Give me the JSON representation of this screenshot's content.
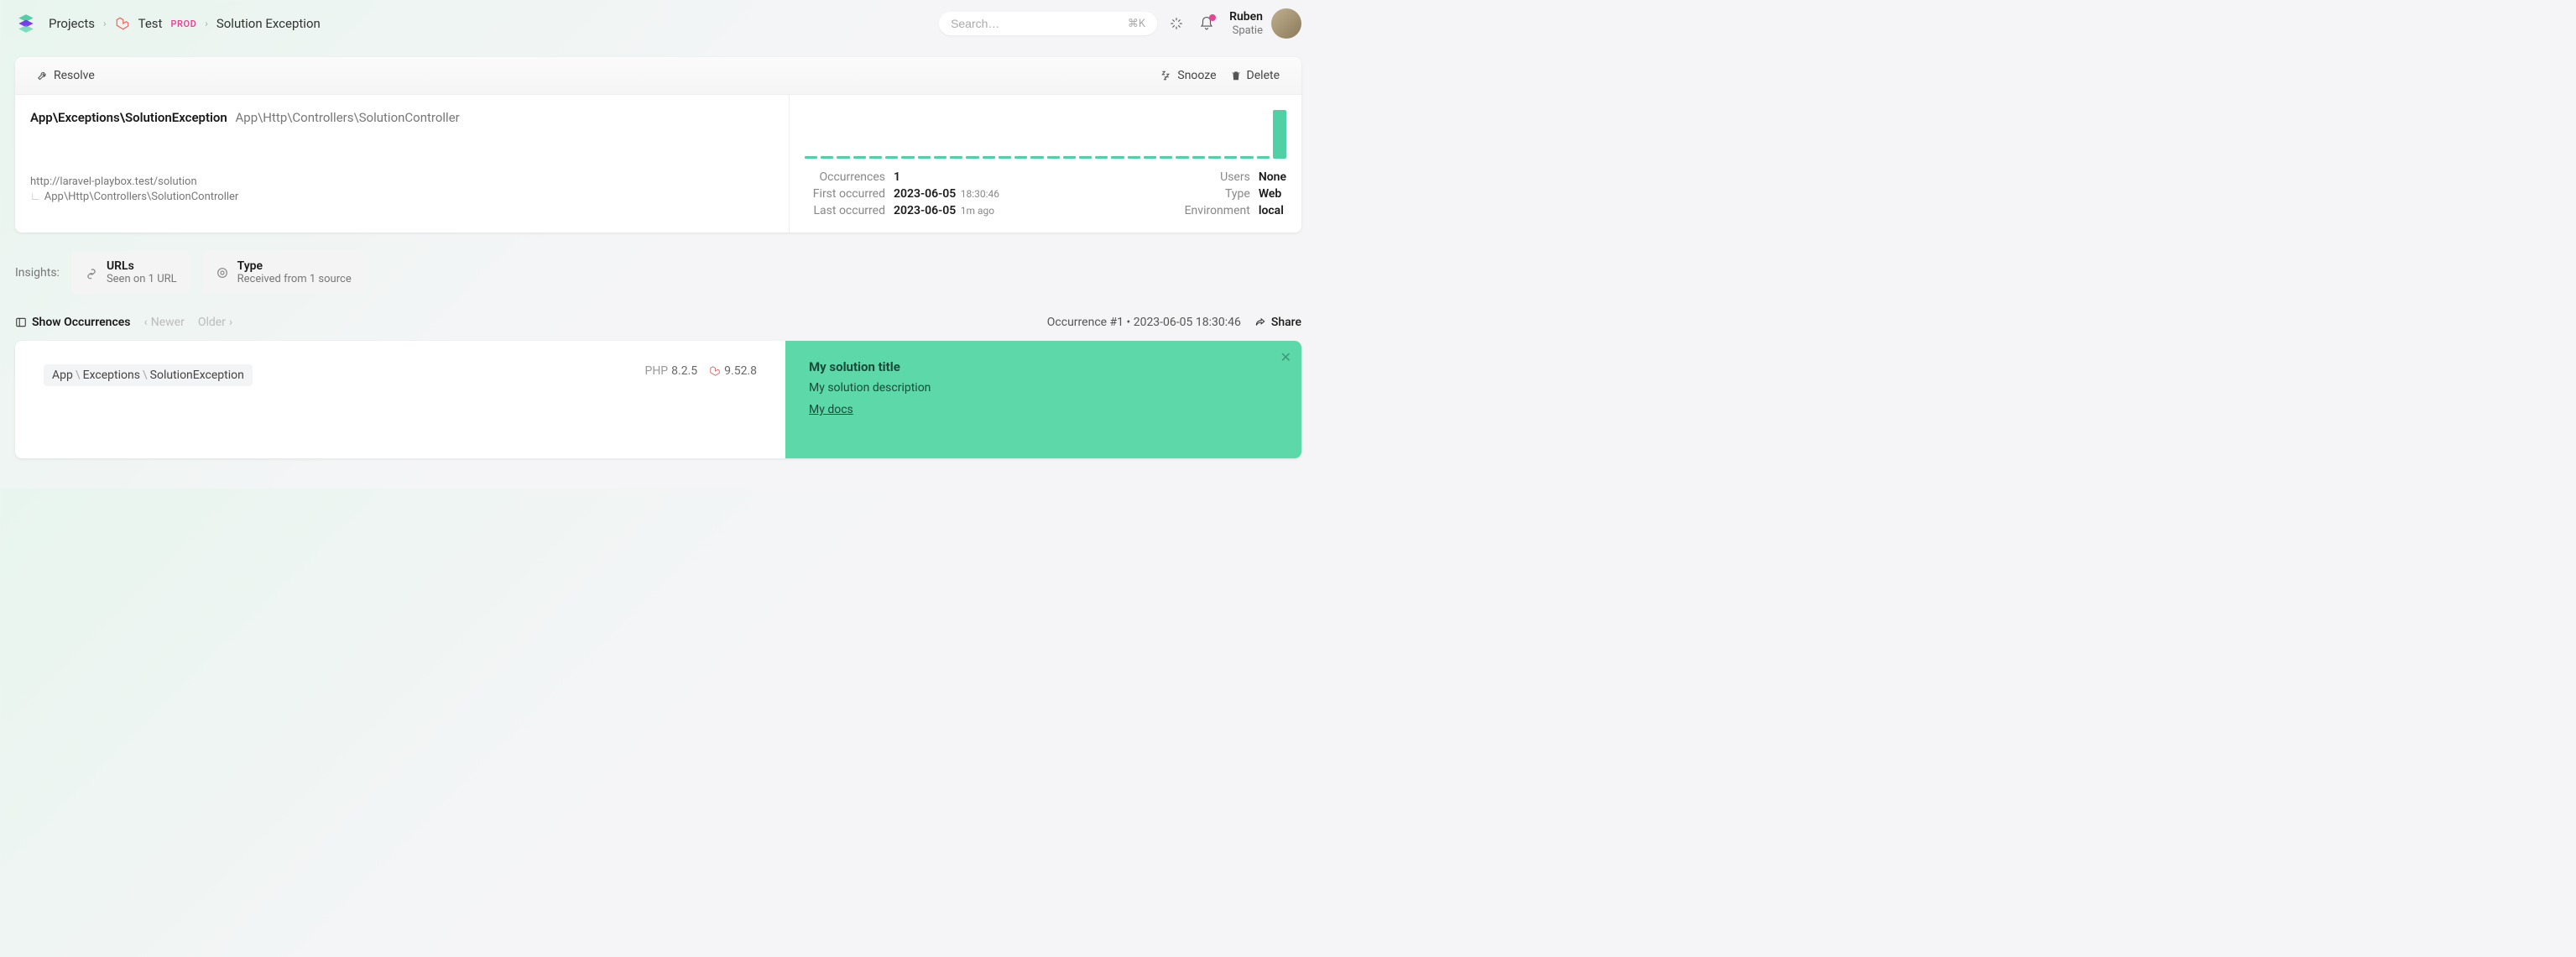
{
  "header": {
    "breadcrumbs": {
      "projects": "Projects",
      "app": "Test",
      "env": "PROD",
      "current": "Solution Exception"
    },
    "search": {
      "placeholder": "Search…",
      "kbd": "⌘K"
    },
    "user": {
      "name": "Ruben",
      "org": "Spatie"
    }
  },
  "toolbar": {
    "resolve": "Resolve",
    "snooze": "Snooze",
    "delete": "Delete"
  },
  "exception": {
    "class": "App\\Exceptions\\SolutionException",
    "controller": "App\\Http\\Controllers\\SolutionController",
    "url": "http://laravel-playbox.test/solution",
    "controller_line": "App\\Http\\Controllers\\SolutionController"
  },
  "stats": {
    "occurrences": {
      "label": "Occurrences",
      "value": "1"
    },
    "first": {
      "label": "First occurred",
      "date": "2023-06-05",
      "time": "18:30:46"
    },
    "last": {
      "label": "Last occurred",
      "date": "2023-06-05",
      "ago": "1m ago"
    },
    "users": {
      "label": "Users",
      "value": "None"
    },
    "type": {
      "label": "Type",
      "value": "Web"
    },
    "env": {
      "label": "Environment",
      "value": "local"
    }
  },
  "insights": {
    "label": "Insights:",
    "urls": {
      "title": "URLs",
      "sub": "Seen on 1 URL"
    },
    "type": {
      "title": "Type",
      "sub": "Received from 1 source"
    }
  },
  "occbar": {
    "show": "Show Occurrences",
    "newer": "Newer",
    "older": "Older",
    "meta_prefix": "Occurrence #1 • ",
    "meta_date": "2023-06-05",
    "meta_time": "18:30:46",
    "share": "Share"
  },
  "occurrence": {
    "ns1": "App",
    "ns2": "Exceptions",
    "ns3": "SolutionException",
    "php_label": "PHP",
    "php_version": "8.2.5",
    "laravel_version": "9.52.8"
  },
  "solution": {
    "title": "My solution title",
    "desc": "My solution description",
    "link": "My docs"
  }
}
